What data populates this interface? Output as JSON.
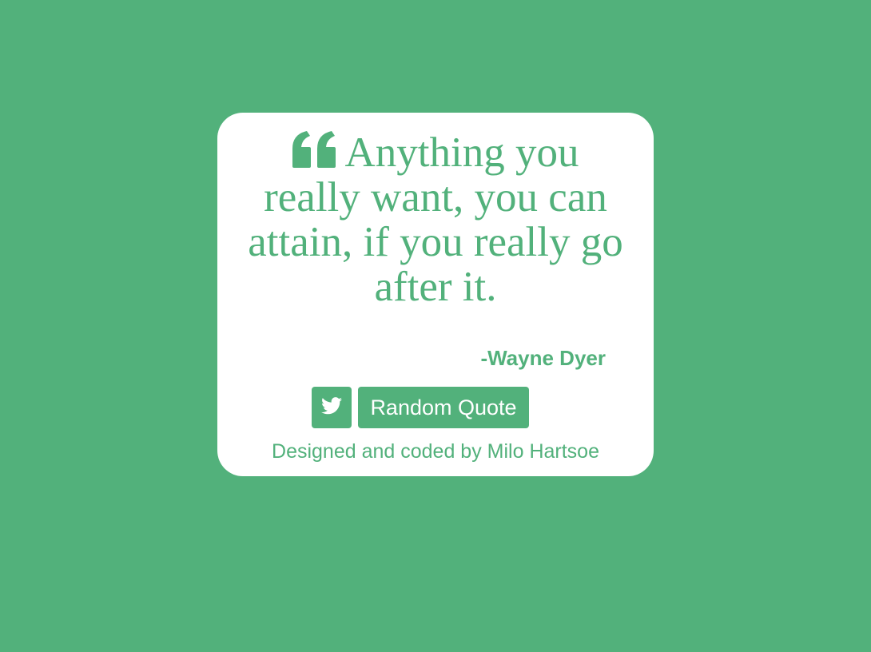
{
  "quote": {
    "text": "Anything you really want, you can attain, if you really go after it.",
    "icon": "quote-left-icon"
  },
  "author": {
    "text": "-Wayne Dyer"
  },
  "buttons": {
    "tweet_icon": "twitter-icon",
    "random_label": "Random Quote"
  },
  "footer": {
    "credit": "Designed and coded by Milo Hartsoe"
  },
  "colors": {
    "background": "#52b17b",
    "card": "#ffffff",
    "accent": "#52b17b"
  }
}
